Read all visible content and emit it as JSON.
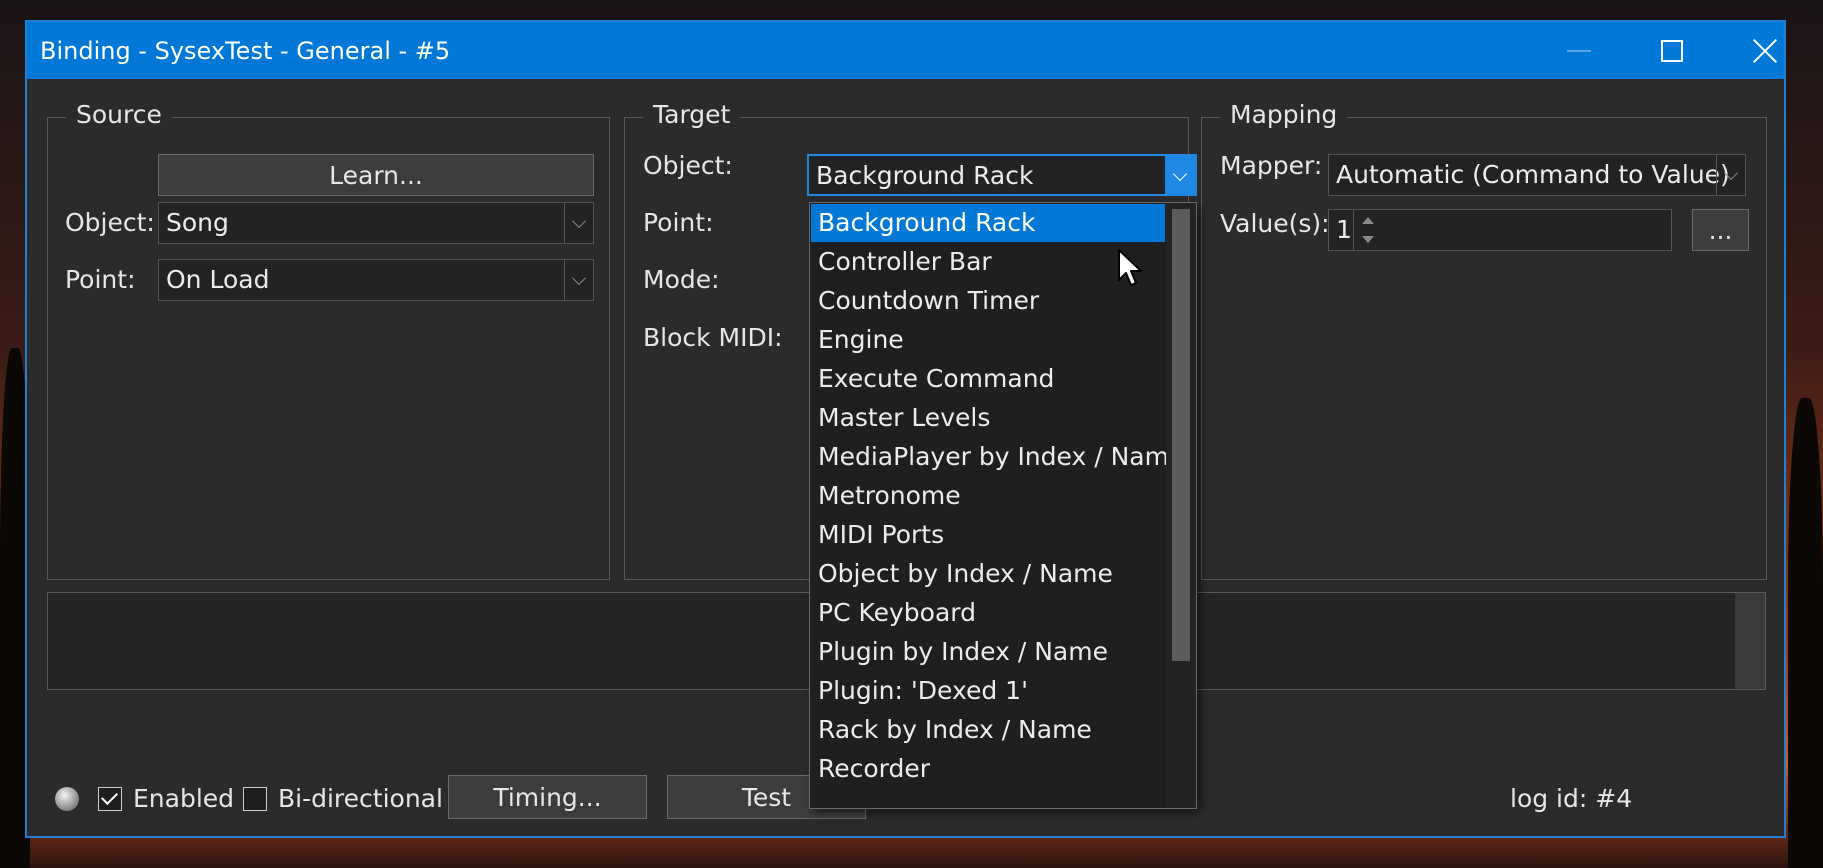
{
  "window": {
    "title": "Binding - SysexTest - General - #5"
  },
  "source": {
    "group_title": "Source",
    "learn_button": "Learn...",
    "object_label": "Object:",
    "object_value": "Song",
    "point_label": "Point:",
    "point_value": "On Load"
  },
  "target": {
    "group_title": "Target",
    "object_label": "Object:",
    "object_value": "Background Rack",
    "point_label": "Point:",
    "mode_label": "Mode:",
    "block_midi_label": "Block MIDI:",
    "dropdown_items": [
      "Background Rack",
      "Controller Bar",
      "Countdown Timer",
      "Engine",
      "Execute Command",
      "Master Levels",
      "MediaPlayer by Index / Name",
      "Metronome",
      "MIDI Ports",
      "Object by Index / Name",
      "PC Keyboard",
      "Plugin by Index / Name",
      "Plugin: 'Dexed 1'",
      "Rack by Index / Name",
      "Recorder"
    ],
    "selected_index": 0
  },
  "mapping": {
    "group_title": "Mapping",
    "mapper_label": "Mapper:",
    "mapper_value": "Automatic (Command to Value)",
    "values_label": "Value(s):",
    "values_value": "1",
    "ellipsis_button": "..."
  },
  "footer": {
    "enabled_label": "Enabled",
    "enabled_checked": true,
    "bidirectional_label": "Bi-directional",
    "bidirectional_checked": false,
    "timing_button": "Timing...",
    "test_button": "Test",
    "log_id": "log id: #4"
  },
  "colors": {
    "accent": "#0078d7",
    "background": "#2b2b2b"
  }
}
